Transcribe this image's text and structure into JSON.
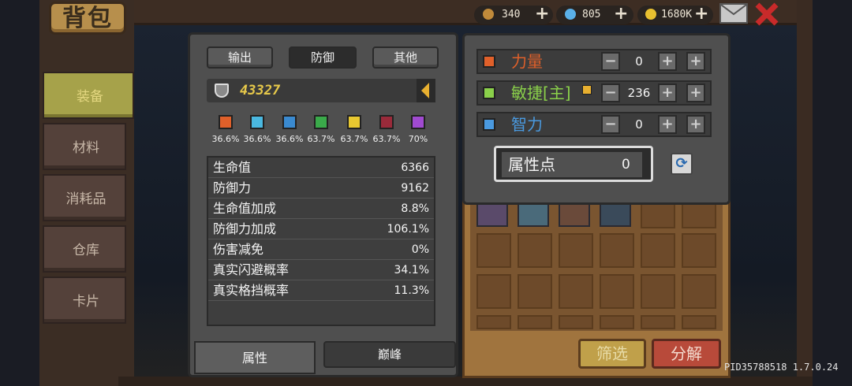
{
  "title": "背包",
  "currency": [
    {
      "icon": "wood-icon",
      "value": "340"
    },
    {
      "icon": "gem-icon",
      "value": "805"
    },
    {
      "icon": "gold-coin-icon",
      "value": "1680K"
    }
  ],
  "nav": [
    {
      "label": "装备",
      "active": true
    },
    {
      "label": "材料",
      "active": false
    },
    {
      "label": "消耗品",
      "active": false
    },
    {
      "label": "仓库",
      "active": false
    },
    {
      "label": "卡片",
      "active": false
    }
  ],
  "stats_panel": {
    "tabs": [
      "输出",
      "防御",
      "其他"
    ],
    "active_tab": "防御",
    "power": "43327",
    "resistances": [
      {
        "icon": "fire-resist-icon",
        "value": "36.6%",
        "color": "#e0602a"
      },
      {
        "icon": "ice-resist-icon",
        "value": "36.6%",
        "color": "#4ab8e0"
      },
      {
        "icon": "water-resist-icon",
        "value": "36.6%",
        "color": "#3a8ad0"
      },
      {
        "icon": "poison-resist-icon",
        "value": "63.7%",
        "color": "#3aaa4a"
      },
      {
        "icon": "light-resist-icon",
        "value": "63.7%",
        "color": "#e8c830"
      },
      {
        "icon": "dark-resist-icon",
        "value": "63.7%",
        "color": "#9a2a3a"
      },
      {
        "icon": "arcane-resist-icon",
        "value": "70%",
        "color": "#a04ad0"
      }
    ],
    "stats": [
      {
        "name": "生命值",
        "value": "6366"
      },
      {
        "name": "防御力",
        "value": "9162"
      },
      {
        "name": "生命值加成",
        "value": "8.8%"
      },
      {
        "name": "防御力加成",
        "value": "106.1%"
      },
      {
        "name": "伤害减免",
        "value": "0%"
      },
      {
        "name": "真实闪避概率",
        "value": "34.1%"
      },
      {
        "name": "真实格挡概率",
        "value": "11.3%"
      }
    ],
    "bottom_tabs": [
      "属性",
      "巅峰"
    ]
  },
  "attributes": {
    "rows": [
      {
        "name": "力量",
        "value": "0",
        "color": "#e0602a",
        "icon": "fist-icon"
      },
      {
        "name": "敏捷[主]",
        "value": "236",
        "color": "#8ad04a",
        "icon": "feather-icon"
      },
      {
        "name": "智力",
        "value": "0",
        "color": "#4a9ae0",
        "icon": "book-icon"
      }
    ],
    "points_label": "属性点",
    "points_value": "0"
  },
  "inventory": {
    "filter_label": "筛选",
    "decompose_label": "分解"
  },
  "version": "PID35788518 1.7.0.24"
}
